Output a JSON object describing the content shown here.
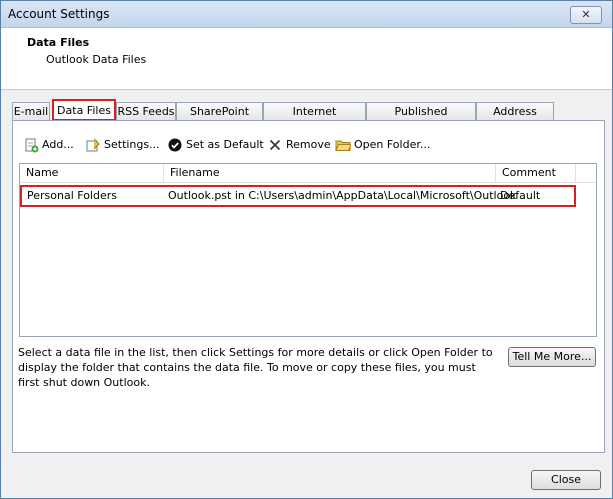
{
  "window": {
    "title": "Account Settings",
    "close_glyph": "✕"
  },
  "header": {
    "title": "Data Files",
    "subtitle": "Outlook Data Files"
  },
  "tabs": [
    {
      "label": "E-mail"
    },
    {
      "label": "Data Files"
    },
    {
      "label": "RSS Feeds"
    },
    {
      "label": "SharePoint Lists"
    },
    {
      "label": "Internet Calendars"
    },
    {
      "label": "Published Calendars"
    },
    {
      "label": "Address Books"
    }
  ],
  "toolbar": {
    "add": "Add...",
    "settings": "Settings...",
    "set_default": "Set as Default",
    "remove": "Remove",
    "open_folder": "Open Folder..."
  },
  "list": {
    "columns": [
      "Name",
      "Filename",
      "Comment"
    ],
    "rows": [
      {
        "name": "Personal Folders",
        "filename": "Outlook.pst in C:\\Users\\admin\\AppData\\Local\\Microsoft\\Outlook",
        "comment": "Default"
      }
    ]
  },
  "info_text": "Select a data file in the list, then click Settings for more details or click Open Folder to display the folder that contains the data file. To move or copy these files, you must first shut down Outlook.",
  "buttons": {
    "tell_me_more": "Tell Me More...",
    "close": "Close"
  },
  "colors": {
    "highlight": "#d61f26",
    "titlebar": "#c3d6ec"
  }
}
